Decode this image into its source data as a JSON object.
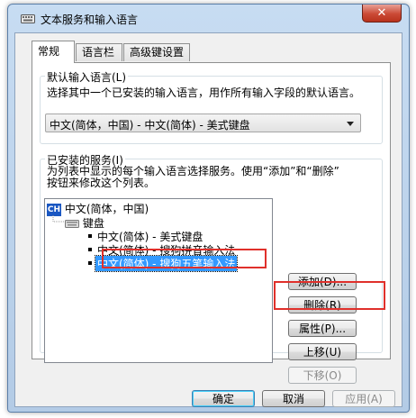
{
  "window": {
    "title": "文本服务和输入语言",
    "close_label": "✕"
  },
  "tabs": [
    {
      "label": "常规",
      "active": true
    },
    {
      "label": "语言栏",
      "active": false
    },
    {
      "label": "高级键设置",
      "active": false
    }
  ],
  "default_language": {
    "group_label": "默认输入语言(L)",
    "description": "选择其中一个已安装的输入语言，用作所有输入字段的默认语言。",
    "selected_value": "中文(简体，中国) - 中文(简体) - 美式键盘"
  },
  "installed_services": {
    "group_label": "已安装的服务(I)",
    "description_line1": "为列表中显示的每个输入语言选择服务。使用“添加”和“删除”",
    "description_line2": "按钮来修改这个列表。",
    "language_badge": "CH",
    "language": "中文(简体，中国)",
    "category": "键盘",
    "items": [
      "中文(简体) - 美式键盘",
      "中文(简体) - 搜狗拼音输入法",
      "中文(简体) - 搜狗五笔输入法"
    ],
    "selected_index": 2,
    "buttons": {
      "add": "添加(D)...",
      "remove": "删除(R)",
      "properties": "属性(P)...",
      "move_up": "上移(U)",
      "move_down": "下移(O)"
    }
  },
  "footer": {
    "ok": "确定",
    "cancel": "取消",
    "apply": "应用(A)"
  },
  "colors": {
    "highlight_box": "#e0302b",
    "selection": "#3399ff",
    "language_badge": "#1a57c2"
  }
}
